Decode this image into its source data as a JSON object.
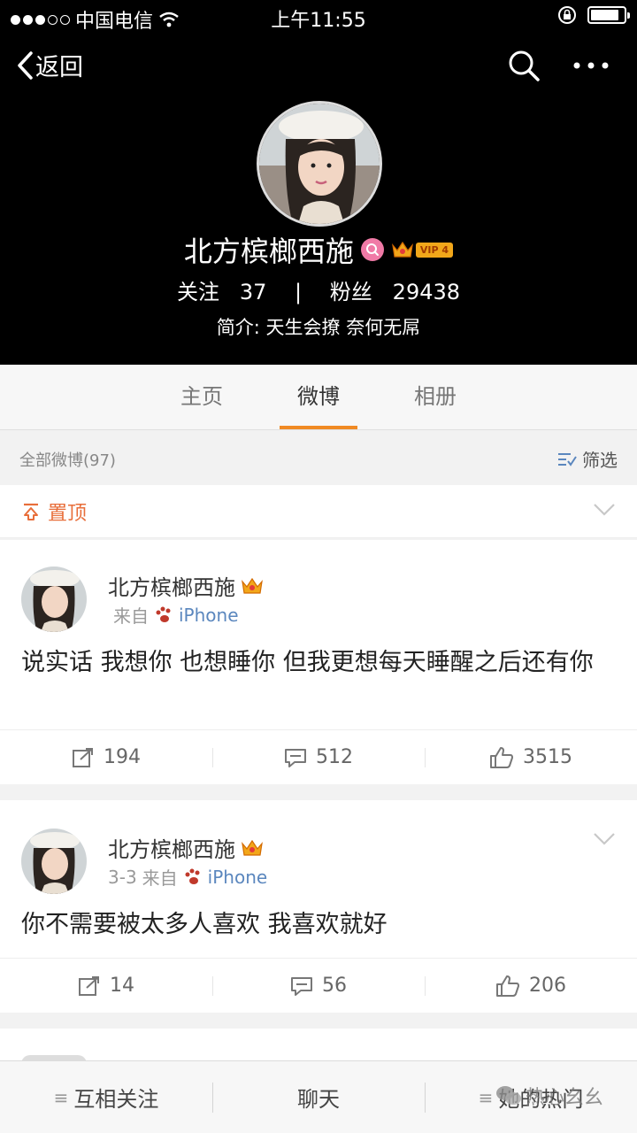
{
  "status_bar": {
    "carrier": "中国电信",
    "time": "上午11:55"
  },
  "nav": {
    "back_label": "返回"
  },
  "profile": {
    "name": "北方槟榔西施",
    "vip_level": "VIP 4",
    "following_label": "关注",
    "following_count": "37",
    "followers_label": "粉丝",
    "followers_count": "29438",
    "bio": "简介: 天生会撩 奈何无屌"
  },
  "tabs": [
    {
      "label": "主页",
      "active": false
    },
    {
      "label": "微博",
      "active": true
    },
    {
      "label": "相册",
      "active": false
    }
  ],
  "filter": {
    "all_count_label": "全部微博(97)",
    "filter_label": "筛选"
  },
  "pinned": {
    "label": "置顶"
  },
  "posts": [
    {
      "author": "北方槟榔西施",
      "date": "",
      "source_prefix": "来自",
      "source": "iPhone",
      "text": "说实话 我想你 也想睡你 但我更想每天睡醒之后还有你",
      "reposts": "194",
      "comments": "512",
      "likes": "3515"
    },
    {
      "author": "北方槟榔西施",
      "date": "3-3",
      "source_prefix": "来自",
      "source": "iPhone",
      "text": "你不需要被太多人喜欢 我喜欢就好",
      "reposts": "14",
      "comments": "56",
      "likes": "206"
    }
  ],
  "bottom_bar": {
    "items": [
      "互相关注",
      "聊天",
      "她的热门"
    ]
  },
  "watermark": "热心幺幺",
  "colors": {
    "accent_orange": "#f08a24",
    "pinned_red": "#e86e3a",
    "link_blue": "#5b87be",
    "vip_gold": "#f2a71a"
  }
}
